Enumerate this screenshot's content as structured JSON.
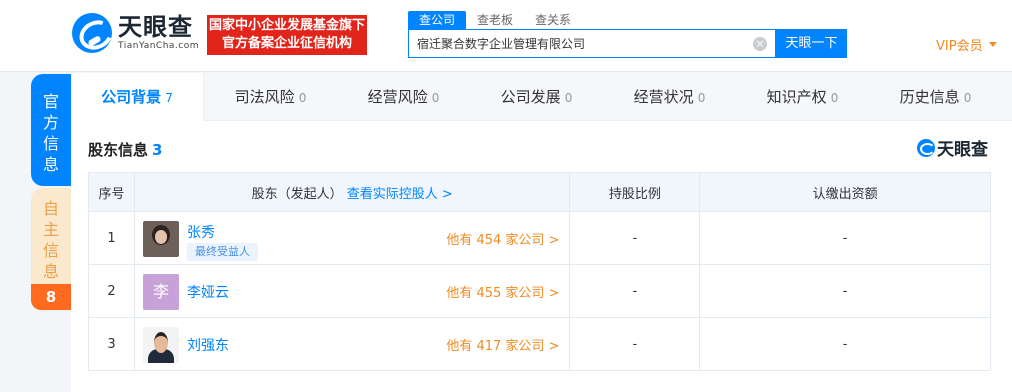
{
  "header": {
    "logo_cn": "天眼查",
    "logo_en": "TianYanCha.com",
    "gov_badge_line1": "国家中小企业发展基金旗下",
    "gov_badge_line2": "官方备案企业征信机构",
    "search_tabs": [
      "查公司",
      "查老板",
      "查关系"
    ],
    "search_value": "宿迁聚合数字企业管理有限公司",
    "search_button": "天眼一下",
    "vip_label": "VIP会员"
  },
  "side_tabs": {
    "official": "官方信息",
    "self": "自主信息",
    "self_count": "8"
  },
  "nav": {
    "items": [
      {
        "label": "公司背景",
        "count": "7"
      },
      {
        "label": "司法风险",
        "count": "0"
      },
      {
        "label": "经营风险",
        "count": "0"
      },
      {
        "label": "公司发展",
        "count": "0"
      },
      {
        "label": "经营状况",
        "count": "0"
      },
      {
        "label": "知识产权",
        "count": "0"
      },
      {
        "label": "历史信息",
        "count": "0"
      }
    ]
  },
  "section": {
    "title": "股东信息",
    "count": "3",
    "brand": "天眼查"
  },
  "table": {
    "headers": {
      "index": "序号",
      "holder": "股东（发起人）",
      "holder_link": "查看实际控股人 >",
      "ratio": "持股比例",
      "amount": "认缴出资额"
    },
    "rows": [
      {
        "index": "1",
        "name": "张秀",
        "tag": "最终受益人",
        "companies": "他有 454 家公司 >",
        "ratio": "-",
        "amount": "-"
      },
      {
        "index": "2",
        "name": "李娅云",
        "avatar_letter": "李",
        "companies": "他有 455 家公司 >",
        "ratio": "-",
        "amount": "-"
      },
      {
        "index": "3",
        "name": "刘强东",
        "companies": "他有 417 家公司 >",
        "ratio": "-",
        "amount": "-"
      }
    ]
  },
  "colors": {
    "accent": "#0084ff",
    "orange": "#f08a24",
    "badge_red": "#e1251b"
  }
}
